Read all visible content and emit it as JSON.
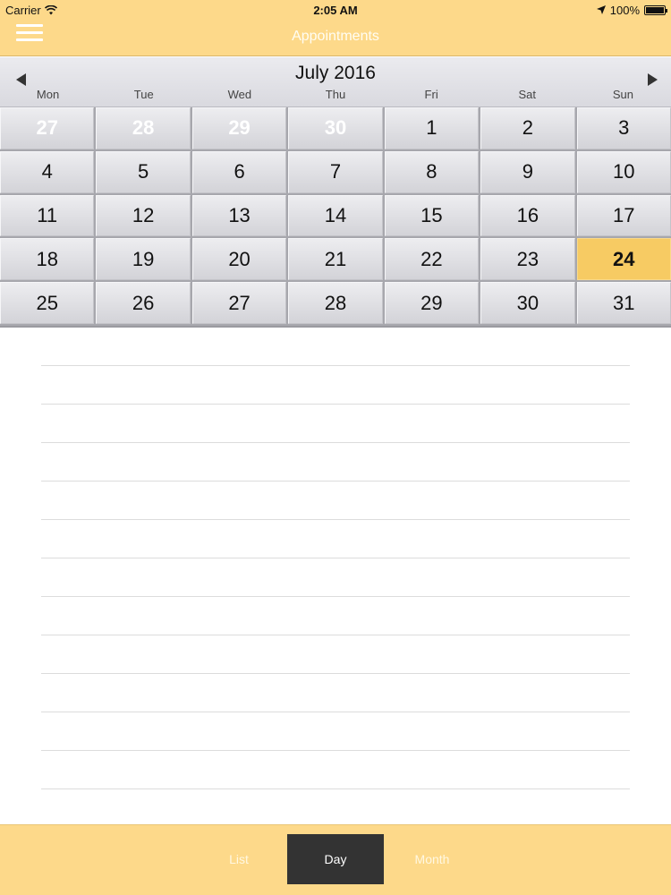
{
  "status_bar": {
    "carrier": "Carrier",
    "time": "2:05 AM",
    "battery": "100%"
  },
  "nav": {
    "title": "Appointments",
    "menu_icon": "hamburger-menu-icon"
  },
  "calendar": {
    "month_title": "July 2016",
    "weekdays": [
      "Mon",
      "Tue",
      "Wed",
      "Thu",
      "Fri",
      "Sat",
      "Sun"
    ],
    "days": [
      {
        "label": "27",
        "other_month": true
      },
      {
        "label": "28",
        "other_month": true
      },
      {
        "label": "29",
        "other_month": true
      },
      {
        "label": "30",
        "other_month": true
      },
      {
        "label": "1"
      },
      {
        "label": "2"
      },
      {
        "label": "3"
      },
      {
        "label": "4"
      },
      {
        "label": "5"
      },
      {
        "label": "6"
      },
      {
        "label": "7"
      },
      {
        "label": "8"
      },
      {
        "label": "9"
      },
      {
        "label": "10"
      },
      {
        "label": "11"
      },
      {
        "label": "12"
      },
      {
        "label": "13"
      },
      {
        "label": "14"
      },
      {
        "label": "15"
      },
      {
        "label": "16"
      },
      {
        "label": "17"
      },
      {
        "label": "18"
      },
      {
        "label": "19"
      },
      {
        "label": "20"
      },
      {
        "label": "21"
      },
      {
        "label": "22"
      },
      {
        "label": "23"
      },
      {
        "label": "24",
        "selected": true
      },
      {
        "label": "25"
      },
      {
        "label": "26"
      },
      {
        "label": "27"
      },
      {
        "label": "28"
      },
      {
        "label": "29"
      },
      {
        "label": "30"
      },
      {
        "label": "31"
      }
    ],
    "selected_color": "#f7cb63"
  },
  "tabs": {
    "list": "List",
    "day": "Day",
    "month": "Month",
    "active": "Day"
  },
  "colors": {
    "accent": "#fdd98a",
    "active_tab": "#333333"
  }
}
